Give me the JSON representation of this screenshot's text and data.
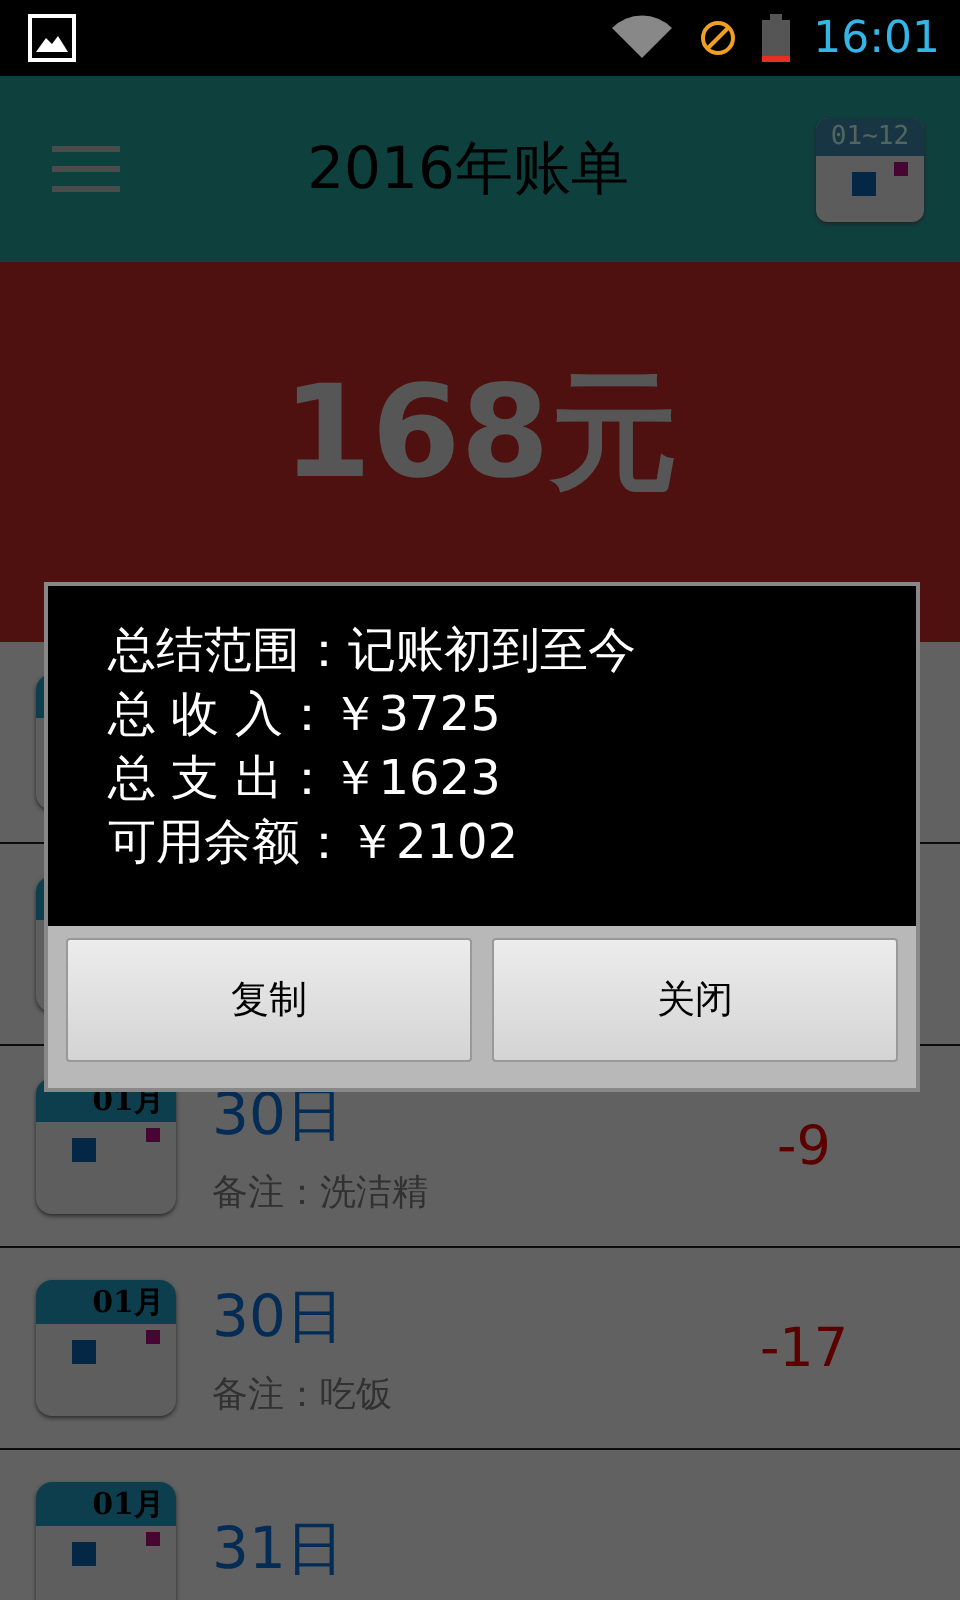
{
  "status_bar": {
    "time": "16:01"
  },
  "app_bar": {
    "title": "2016年账单",
    "calendar_label": "01~12"
  },
  "banner": {
    "amount": "168元"
  },
  "list": {
    "rows": [
      {
        "month": "01月",
        "date": "30日",
        "note": "备注：洗洁精",
        "amount": "-9"
      },
      {
        "month": "01月",
        "date": "30日",
        "note": "备注：吃饭",
        "amount": "-17"
      },
      {
        "month": "01月",
        "date": "31日"
      }
    ]
  },
  "dialog": {
    "lines": [
      "总结范围：记账初到至今",
      "总 收 入：￥3725",
      "总 支 出：￥1623",
      "可用余额：￥2102"
    ],
    "buttons": [
      "复制",
      "关闭"
    ]
  }
}
